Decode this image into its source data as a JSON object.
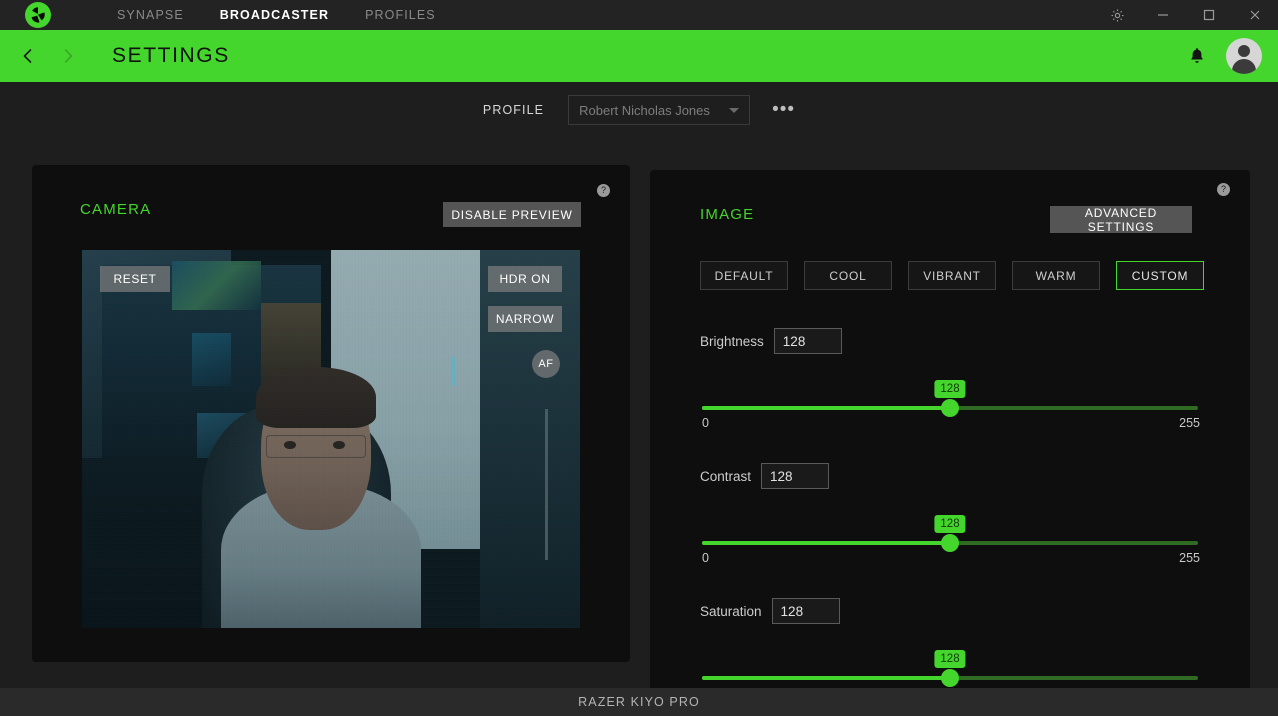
{
  "titlebar": {
    "logo_icon": "razer-logo-icon",
    "tabs": [
      {
        "label": "SYNAPSE",
        "active": false
      },
      {
        "label": "BROADCASTER",
        "active": true
      },
      {
        "label": "PROFILES",
        "active": false
      }
    ],
    "window_controls": [
      {
        "name": "settings-gear-icon",
        "label": ""
      },
      {
        "name": "minimize-icon",
        "label": ""
      },
      {
        "name": "maximize-icon",
        "label": ""
      },
      {
        "name": "close-icon",
        "label": ""
      }
    ]
  },
  "header": {
    "title": "SETTINGS",
    "back_icon": "chevron-left-icon",
    "forward_icon": "chevron-right-icon",
    "bell_icon": "notification-bell-icon",
    "avatar_icon": "user-avatar-icon",
    "accent_color": "#44D62C",
    "title_color": "#111111"
  },
  "profile": {
    "label": "PROFILE",
    "selected": "Robert Nicholas Jones",
    "more_label": "•••"
  },
  "camera_panel": {
    "title": "CAMERA",
    "help_label": "?",
    "disable_preview_label": "DISABLE PREVIEW",
    "overlay": {
      "reset_label": "RESET",
      "hdr_label": "HDR ON",
      "fov_label": "NARROW",
      "af_label": "AF"
    }
  },
  "image_panel": {
    "title": "IMAGE",
    "help_label": "?",
    "advanced_settings_label": "ADVANCED SETTINGS",
    "presets": [
      {
        "label": "DEFAULT",
        "active": false
      },
      {
        "label": "COOL",
        "active": false
      },
      {
        "label": "VIBRANT",
        "active": false
      },
      {
        "label": "WARM",
        "active": false
      },
      {
        "label": "CUSTOM",
        "active": true
      }
    ],
    "sliders": [
      {
        "label": "Brightness",
        "value": "128",
        "badge": "128",
        "min": "0",
        "max": "255",
        "percent": 50
      },
      {
        "label": "Contrast",
        "value": "128",
        "badge": "128",
        "min": "0",
        "max": "255",
        "percent": 50
      },
      {
        "label": "Saturation",
        "value": "128",
        "badge": "128",
        "min": "0",
        "max": "255",
        "percent": 50
      }
    ]
  },
  "statusbar": {
    "device": "RAZER KIYO PRO"
  }
}
